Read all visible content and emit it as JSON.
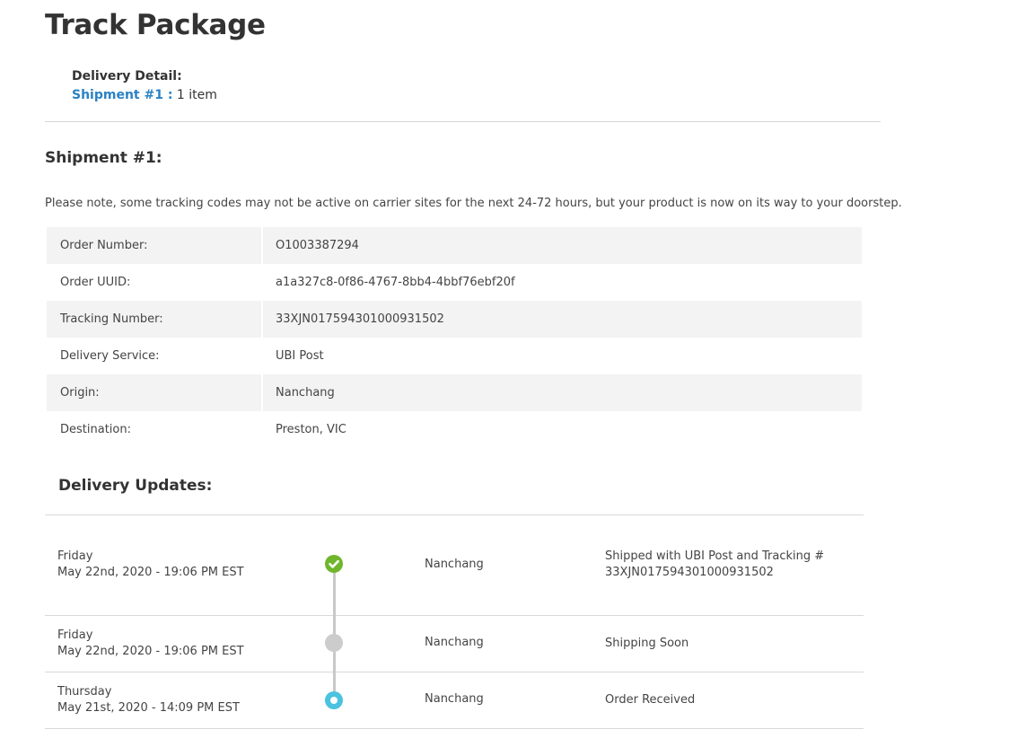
{
  "page": {
    "title": "Track Package"
  },
  "delivery_detail": {
    "heading": "Delivery Detail:",
    "shipment_link": "Shipment #1 :",
    "item_count": "1 item"
  },
  "shipment": {
    "heading": "Shipment #1:",
    "note": "Please note, some tracking codes may not be active on carrier sites for the next 24-72 hours, but your product is now on its way to your doorstep.",
    "details": [
      {
        "label": "Order Number:",
        "value": "O1003387294"
      },
      {
        "label": "Order UUID:",
        "value": "a1a327c8-0f86-4767-8bb4-4bbf76ebf20f"
      },
      {
        "label": "Tracking Number:",
        "value": "33XJN017594301000931502"
      },
      {
        "label": "Delivery Service:",
        "value": "UBI Post"
      },
      {
        "label": "Origin:",
        "value": "Nanchang"
      },
      {
        "label": "Destination:",
        "value": "Preston, VIC"
      }
    ]
  },
  "updates": {
    "heading": "Delivery Updates:",
    "events": [
      {
        "day": "Friday",
        "datetime": "May 22nd, 2020 - 19:06 PM EST",
        "status_icon": "check-complete-icon",
        "status_color": "#70b62c",
        "location": "Nanchang",
        "description_line1": "Shipped with UBI Post and Tracking #",
        "description_line2": "33XJN017594301000931502"
      },
      {
        "day": "Friday",
        "datetime": "May 22nd, 2020 - 19:06 PM EST",
        "status_icon": "pending-dot-icon",
        "status_color": "#cccccc",
        "location": "Nanchang",
        "description_line1": "Shipping Soon"
      },
      {
        "day": "Thursday",
        "datetime": "May 21st, 2020 - 14:09 PM EST",
        "status_icon": "current-dot-icon",
        "status_color": "#4bc3e0",
        "location": "Nanchang",
        "description_line1": "Order Received"
      }
    ]
  },
  "colors": {
    "link": "#2b82c4",
    "stripe": "#f3f3f3",
    "divider": "#d4d4d4",
    "timeline_line": "#c8c8c8"
  }
}
